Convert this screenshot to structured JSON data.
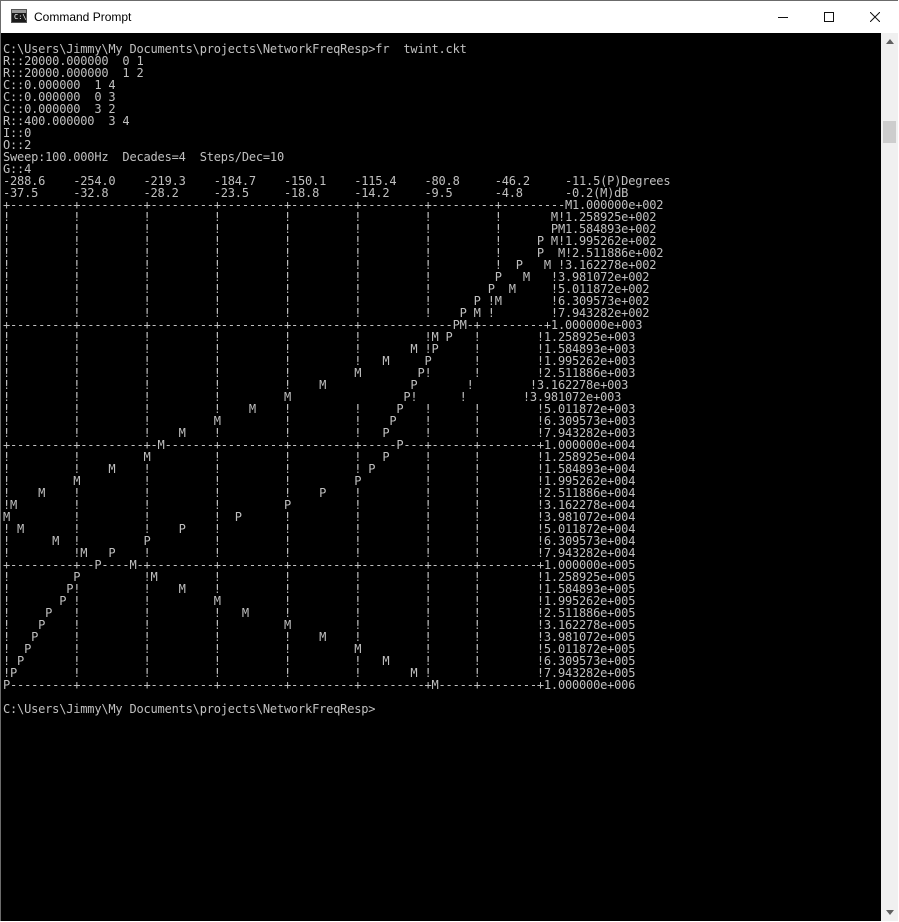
{
  "window": {
    "title": "Command Prompt",
    "icon": "console-icon"
  },
  "controls": {
    "minimize_icon": "minimize-icon",
    "maximize_icon": "maximize-icon",
    "close_icon": "close-icon"
  },
  "console": {
    "lines": [
      "C:\\Users\\Jimmy\\My Documents\\projects\\NetworkFreqResp>fr  twint.ckt",
      "R::20000.000000  0 1",
      "R::20000.000000  1 2",
      "C::0.000000  1 4",
      "C::0.000000  0 3",
      "C::0.000000  3 2",
      "R::400.000000  3 4",
      "I::0",
      "O::2",
      "Sweep:100.000Hz  Decades=4  Steps/Dec=10",
      "G::4",
      "-288.6    -254.0    -219.3    -184.7    -150.1    -115.4    -80.8     -46.2     -11.5(P)Degrees",
      "-37.5     -32.8     -28.2     -23.5     -18.8     -14.2     -9.5      -4.8      -0.2(M)dB",
      "+---------+---------+---------+---------+---------+---------+---------+---------M1.000000e+002",
      "!         !         !         !         !         !         !         !       M!1.258925e+002",
      "!         !         !         !         !         !         !         !       PM1.584893e+002",
      "!         !         !         !         !         !         !         !     P M!1.995262e+002",
      "!         !         !         !         !         !         !         !     P  M!2.511886e+002",
      "!         !         !         !         !         !         !         !  P   M !3.162278e+002",
      "!         !         !         !         !         !         !         P   M   !3.981072e+002",
      "!         !         !         !         !         !         !        P  M     !5.011872e+002",
      "!         !         !         !         !         !         !      P !M       !6.309573e+002",
      "!         !         !         !         !         !         !    P M !        !7.943282e+002",
      "+---------+---------+---------+---------+---------+-------------PM-+---------+1.000000e+003",
      "!         !         !         !         !         !         !M P   !        !1.258925e+003",
      "!         !         !         !         !         !       M !P     !        !1.584893e+003",
      "!         !         !         !         !         !   M     P      !        !1.995262e+003",
      "!         !         !         !         !         M        P!      !        !2.511886e+003",
      "!         !         !         !         !    M            P       !        !3.162278e+003",
      "!         !         !         !         M                P!      !        !3.981072e+003",
      "!         !         !         !    M    !         !     P   !      !        !5.011872e+003",
      "!         !         !         M         !         !    P    !      !        !6.309573e+003",
      "!         !         !    M    !         !         !   P     !      !        !7.943282e+003",
      "+---------+---------+-M-------+---------+---------+-----P---+------+--------+1.000000e+004",
      "!         !         M         !         !         !   P     !      !        !1.258925e+004",
      "!         !    M    !         !         !         ! P       !      !        !1.584893e+004",
      "!         M         !         !         !         P         !      !        !1.995262e+004",
      "!    M    !         !         !         !    P    !         !      !        !2.511886e+004",
      "!M        !         !         !         P         !         !      !        !3.162278e+004",
      "M         !         !         !  P      !         !         !      !        !3.981072e+004",
      "! M       !         !    P    !         !         !         !      !        !5.011872e+004",
      "!      M  !         P         !         !         !         !      !        !6.309573e+004",
      "!         !M   P    !         !         !         !         !      !        !7.943282e+004",
      "+---------+--P----M-+---------+---------+---------+---------+------+--------+1.000000e+005",
      "!         P         !M        !         !         !         !      !        !1.258925e+005",
      "!        P!         !    M    !         !         !         !      !        !1.584893e+005",
      "!       P !         !         M         !         !         !      !        !1.995262e+005",
      "!     P   !         !         !   M     !         !         !      !        !2.511886e+005",
      "!    P    !         !         !         M         !         !      !        !3.162278e+005",
      "!   P     !         !         !         !    M    !         !      !        !3.981072e+005",
      "!  P      !         !         !         !         M         !      !        !5.011872e+005",
      "! P       !         !         !         !         !   M     !      !        !6.309573e+005",
      "!P        !         !         !         !         !       M !      !        !7.943282e+005",
      "P---------+---------+---------+---------+---------+---------+M-----+--------+1.000000e+006",
      "",
      "C:\\Users\\Jimmy\\My Documents\\projects\\NetworkFreqResp>"
    ]
  },
  "scrollbar": {
    "up_icon": "scroll-up-arrow-icon",
    "down_icon": "scroll-down-arrow-icon"
  }
}
